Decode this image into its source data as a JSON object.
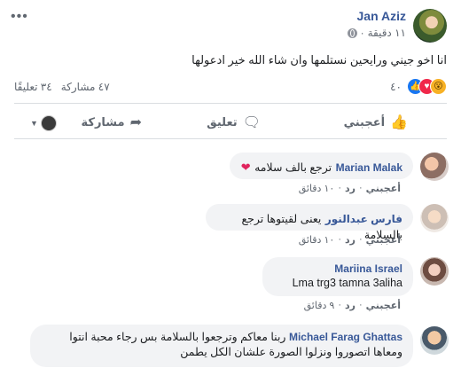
{
  "post": {
    "author": "Jan Aziz",
    "time": "١١ دقيقة",
    "text": "انا اخو جيني ورايحين نستلمها وان شاء الله خير ادعولها",
    "reaction_count": "٤٠",
    "comments_count": "٣٤ تعليقًا",
    "shares_count": "٤٧ مشاركة"
  },
  "actions": {
    "like": "أعجبني",
    "comment": "تعليق",
    "share": "مشاركة"
  },
  "icons": {
    "more": "more-dots-icon",
    "globe": "globe-icon",
    "like_reaction": "like-reaction-icon",
    "love_reaction": "love-reaction-icon",
    "wow_reaction": "wow-reaction-icon",
    "like_action": "thumbs-up-icon",
    "comment_action": "speech-bubble-icon",
    "share_action": "share-arrow-icon",
    "heart": "heart-icon"
  },
  "comments": [
    {
      "name": "Marian Malak",
      "text": "ترجع بالف سلامه",
      "like": "أعجبني",
      "reply": "رد",
      "time": "١٠ دقائق"
    },
    {
      "name": "فارس عبدالنور",
      "text": "يعنى لقيتوها ترجع بالسلامة",
      "like": "أعجبني",
      "reply": "رد",
      "time": "١٠ دقائق"
    },
    {
      "name": "Mariina Israel",
      "text": "Lma trg3 tamna 3aliha",
      "like": "أعجبني",
      "reply": "رد",
      "time": "٩ دقائق"
    },
    {
      "name": "Michael Farag Ghattas",
      "text": "ربنا معاكم وترجعوا بالسلامة بس رجاء محبة انتوا ومعاها اتصوروا ونزلوا الصورة علشان الكل يطمن"
    }
  ],
  "colors": {
    "link_blue": "#385898",
    "bubble_gray": "#f2f3f5",
    "like_blue": "#1877f2",
    "love_red": "#f0284a",
    "wow_yellow": "#f7b125"
  }
}
